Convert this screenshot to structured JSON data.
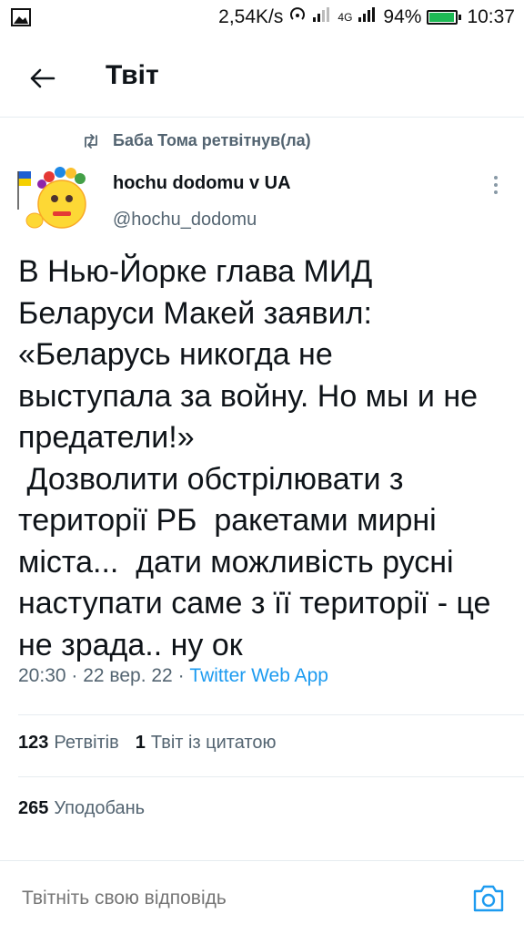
{
  "status_bar": {
    "speed": "2,54K/s",
    "network": "4G",
    "battery": "94%",
    "battery_level": 0.94,
    "time": "10:37"
  },
  "header": {
    "title": "Твіт"
  },
  "retweet": {
    "label": "Баба Тома ретвітнув(ла)"
  },
  "author": {
    "name": "hochu dodomu v UA",
    "handle": "@hochu_dodomu"
  },
  "tweet": {
    "text": "В Нью-Йорке глава МИД\nБеларуси Макей заявил:\n«Беларусь никогда не\nвыступала за войну. Но мы и не\nпредатели!»\n Дозволити обстрілювати з\nтериторії РБ  ракетами мирні\nміста...  дати можливість русні\nнаступати саме з її території - це\nне зрада.. ну ок",
    "time": "20:30",
    "date": "22 вер. 22",
    "source": "Twitter Web App"
  },
  "stats": {
    "retweets_count": "123",
    "retweets_label": "Ретвітів",
    "quotes_count": "1",
    "quotes_label": "Твіт із цитатою",
    "likes_count": "265",
    "likes_label": "Уподобань"
  },
  "reply": {
    "placeholder": "Твітніть свою відповідь"
  },
  "colors": {
    "accent": "#1d9bf0",
    "secondary_text": "#536471",
    "divider": "#e6ecf0"
  }
}
